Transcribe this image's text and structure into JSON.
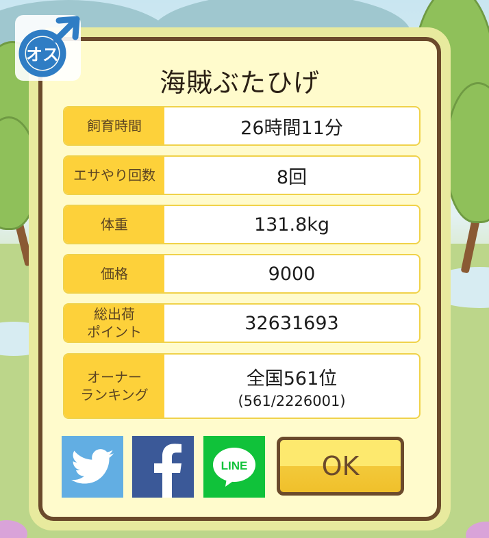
{
  "pig_name": "海賊ぶたひげ",
  "badge_text": "オス",
  "stats": [
    {
      "label_lines": [
        "飼育時間"
      ],
      "value": "26時間11分",
      "sub": ""
    },
    {
      "label_lines": [
        "エサやり回数"
      ],
      "value": "8回",
      "sub": ""
    },
    {
      "label_lines": [
        "体重"
      ],
      "value": "131.8kg",
      "sub": ""
    },
    {
      "label_lines": [
        "価格"
      ],
      "value": "9000",
      "sub": ""
    },
    {
      "label_lines": [
        "総出荷",
        "ポイント"
      ],
      "value": "32631693",
      "sub": ""
    },
    {
      "label_lines": [
        "オーナー",
        "ランキング"
      ],
      "value": "全国561位",
      "sub": "(561/2226001)"
    }
  ],
  "share_buttons": {
    "twitter_icon": "twitter-bird-icon",
    "facebook_icon": "facebook-f-icon",
    "line_icon": "line-bubble-icon",
    "line_text": "LINE"
  },
  "ok_label": "OK",
  "colors": {
    "label_bg": "#fdd13a",
    "frame_brown": "#6b4a2b",
    "twitter": "#62aee3",
    "facebook": "#3b5998",
    "line": "#10c23a"
  }
}
